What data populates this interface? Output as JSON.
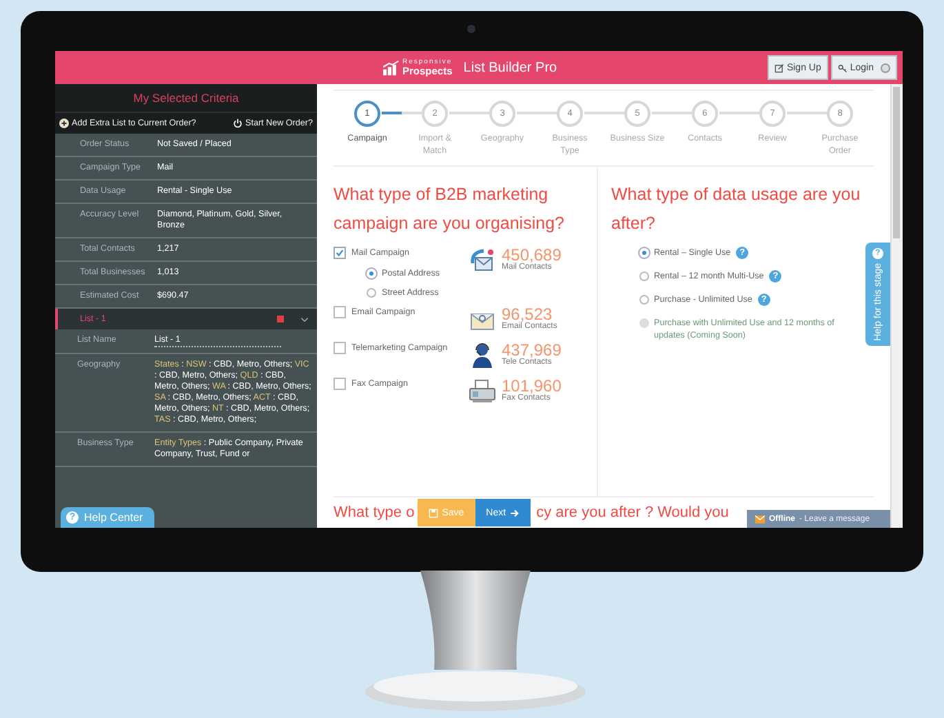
{
  "header": {
    "logo_top": "Responsive",
    "logo_bottom": "Prospects",
    "app_title": "List Builder Pro",
    "buttons": [
      {
        "label": "Sign Up",
        "kind": "signup"
      },
      {
        "label": "Login",
        "kind": "login"
      }
    ]
  },
  "sidebar": {
    "title": "My Selected Criteria",
    "actions": [
      {
        "label": "Add Extra List to Current Order?",
        "kind": "add"
      },
      {
        "label": "Start New Order?",
        "kind": "power"
      }
    ],
    "rows": [
      {
        "label": "Order Status",
        "value": "Not Saved / Placed"
      },
      {
        "label": "Campaign Type",
        "value": "Mail"
      },
      {
        "label": "Data Usage",
        "value": "Rental - Single Use"
      },
      {
        "label": "Accuracy Level",
        "value": "Diamond, Platinum, Gold, Silver, Bronze"
      },
      {
        "label": "Total Contacts",
        "value": "1,217"
      },
      {
        "label": "Total Businesses",
        "value": "1,013"
      },
      {
        "label": "Estimated Cost",
        "value": "$690.47"
      }
    ],
    "list": {
      "title": "List - 1",
      "name_label": "List Name",
      "name_value": "List - 1",
      "details": [
        {
          "label": "Geography",
          "parts": [
            {
              "code": "States",
              "text": " : "
            },
            {
              "code": "NSW",
              "text": " : CBD, Metro, Others; "
            },
            {
              "code": "VIC",
              "text": " : CBD, Metro, Others; "
            },
            {
              "code": "QLD",
              "text": " : CBD, Metro, Others; "
            },
            {
              "code": "WA",
              "text": " : CBD, Metro, Others; "
            },
            {
              "code": "SA",
              "text": " : CBD, Metro, Others; "
            },
            {
              "code": "ACT",
              "text": " : CBD, Metro, Others; "
            },
            {
              "code": "NT",
              "text": " : CBD, Metro, Others; "
            },
            {
              "code": "TAS",
              "text": " : CBD, Metro, Others;"
            }
          ]
        },
        {
          "label": "Business Type",
          "parts": [
            {
              "code": "Entity Types",
              "text": " : Public Company, Private Company, Trust, Fund or"
            }
          ]
        }
      ]
    },
    "help_center": "Help Center",
    "help_center_icon": "?"
  },
  "steps": [
    {
      "number": "1",
      "label": "Campaign",
      "selected": true
    },
    {
      "number": "2",
      "label": "Import & Match",
      "selected": false
    },
    {
      "number": "3",
      "label": "Geography",
      "selected": false
    },
    {
      "number": "4",
      "label": "Business Type",
      "selected": false
    },
    {
      "number": "5",
      "label": "Business Size",
      "selected": false
    },
    {
      "number": "6",
      "label": "Contacts",
      "selected": false
    },
    {
      "number": "7",
      "label": "Review",
      "selected": false
    },
    {
      "number": "8",
      "label": "Purchase Order",
      "selected": false
    }
  ],
  "campaign": {
    "question": "What type of B2B marketing campaign are you organising?",
    "options": [
      {
        "label": "Mail Campaign",
        "checked": true,
        "kind": "mail",
        "count": "450,689",
        "count_label": "Mail Contacts",
        "sub_options": [
          {
            "label": "Postal Address",
            "selected": true
          },
          {
            "label": "Street Address",
            "selected": false
          }
        ]
      },
      {
        "label": "Email Campaign",
        "checked": false,
        "kind": "email",
        "count": "96,523",
        "count_label": "Email Contacts"
      },
      {
        "label": "Telemarketing Campaign",
        "checked": false,
        "kind": "tele",
        "count": "437,969",
        "count_label": "Tele Contacts"
      },
      {
        "label": "Fax Campaign",
        "checked": false,
        "kind": "fax",
        "count": "101,960",
        "count_label": "Fax Contacts"
      }
    ]
  },
  "usage": {
    "question": "What type of data usage are you after?",
    "options": [
      {
        "label": "Rental – Single Use",
        "selected": true,
        "disabled": false,
        "help_icon": "?"
      },
      {
        "label": "Rental – 12 month Multi-Use",
        "selected": false,
        "disabled": false,
        "help_icon": "?"
      },
      {
        "label": "Purchase - Unlimited Use",
        "selected": false,
        "disabled": false,
        "help_icon": "?"
      },
      {
        "label": "Purchase with Unlimited Use and 12 months of updates (Coming Soon)",
        "selected": false,
        "disabled": true
      }
    ]
  },
  "next_question": {
    "start": "What type o",
    "end": "cy are you after ? Would you"
  },
  "buttons": [
    {
      "label": "Save",
      "kind": "save"
    },
    {
      "label": "Next",
      "kind": "next"
    }
  ],
  "stage_help": "Help for this stage",
  "stage_help_icon": "?",
  "chat": {
    "status": "Offline",
    "message": "- Leave a message"
  }
}
